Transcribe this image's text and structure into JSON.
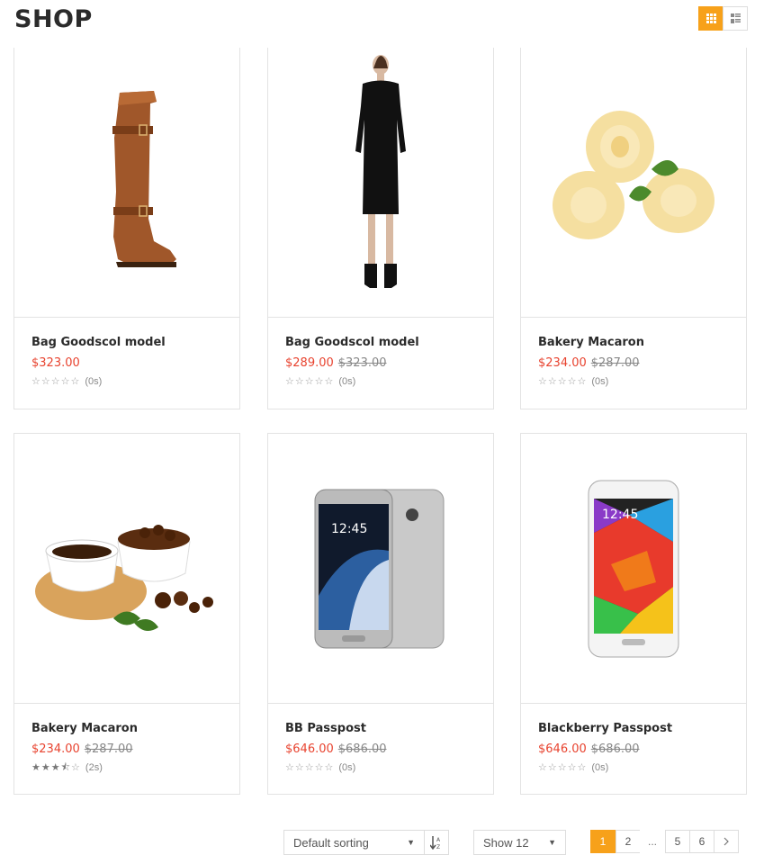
{
  "header": {
    "title": "SHOP"
  },
  "view": {
    "grid_icon": "grid-view-icon",
    "list_icon": "list-view-icon",
    "active": "grid",
    "accent": "#f7a11a"
  },
  "products": [
    {
      "name": "Bag Goodscol model",
      "price": "$323.00",
      "old_price": "",
      "rating": 0,
      "reviews": "(0s)",
      "image": "brown-boot"
    },
    {
      "name": "Bag Goodscol model",
      "price": "$289.00",
      "old_price": "$323.00",
      "rating": 0,
      "reviews": "(0s)",
      "image": "black-dress"
    },
    {
      "name": "Bakery Macaron",
      "price": "$234.00",
      "old_price": "$287.00",
      "rating": 0,
      "reviews": "(0s)",
      "image": "butter-curls"
    },
    {
      "name": "Bakery Macaron",
      "price": "$234.00",
      "old_price": "$287.00",
      "rating": 3.5,
      "reviews": "(2s)",
      "image": "coffee-cups"
    },
    {
      "name": "BB Passpost",
      "price": "$646.00",
      "old_price": "$686.00",
      "rating": 0,
      "reviews": "(0s)",
      "image": "samsung-phone-silver"
    },
    {
      "name": "Blackberry Passpost",
      "price": "$646.00",
      "old_price": "$686.00",
      "rating": 0,
      "reviews": "(0s)",
      "image": "samsung-phone-white"
    }
  ],
  "toolbar": {
    "sort_label": "Default sorting",
    "show_label": "Show 12",
    "pages": [
      "1",
      "2",
      "...",
      "5",
      "6"
    ],
    "current_page": "1",
    "next_icon": "chevron-right-icon"
  }
}
